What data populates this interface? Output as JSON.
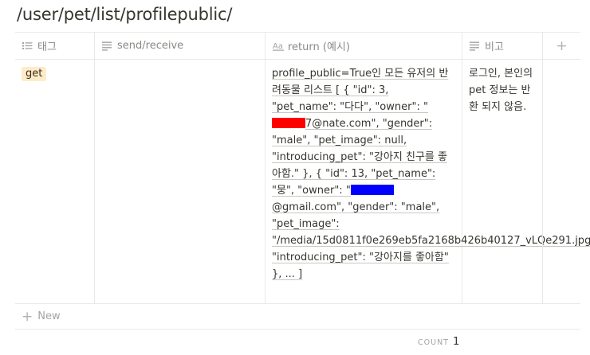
{
  "page": {
    "title": "/user/pet/list/profilepublic/"
  },
  "table": {
    "columns": [
      {
        "label": "태그",
        "icon": "list-icon"
      },
      {
        "label": "send/receive",
        "icon": "text-lines-icon"
      },
      {
        "label": "return (예시)",
        "icon": "text-format-icon"
      },
      {
        "label": "비고",
        "icon": "text-lines-icon"
      }
    ],
    "add_column_symbol": "+",
    "row": {
      "tag": "get",
      "send_receive": "",
      "return_part1": "profile_public=True인 모든 유저의 반려동물 리스트 [ { \"id\": 3, \"pet_name\": \"다다\", \"owner\": \"",
      "return_part2": "7@nate.com\", \"gender\": \"male\", \"pet_image\": null, \"introducing_pet\": \"강아지 친구를 좋아함.\" }, { \"id\": 13, \"pet_name\": \"뭉\", \"owner\": \"",
      "return_part3": "@gmail.com\", \"gender\": \"male\", \"pet_image\": \"/media/15d0811f0e269eb5fa2168b426b40127_vLQe291.jpg\", \"introducing_pet\": \"강아지를 좋아함\" }, ... ]",
      "redaction_colors": [
        "#ff0000",
        "#0000ff"
      ],
      "note": "로그인, 본인의 pet 정보는 반환 되지 않음."
    },
    "new_label": "New",
    "new_symbol": "+"
  },
  "footer": {
    "count_label": "COUNT",
    "count_value": "1"
  }
}
